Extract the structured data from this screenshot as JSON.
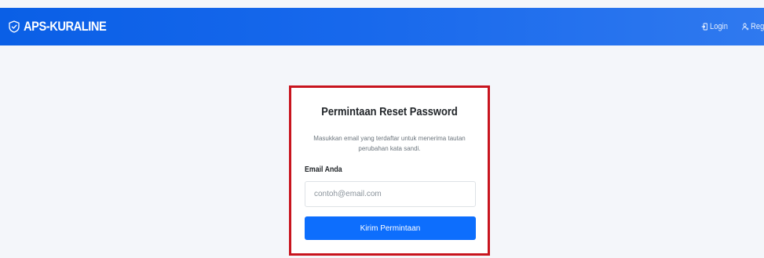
{
  "navbar": {
    "brand": "APS-KURALINE",
    "links": [
      {
        "label": "Login",
        "icon": "login-icon"
      },
      {
        "label": "Register",
        "icon": "user-add-icon"
      }
    ],
    "color": "#0d6efd"
  },
  "reset_card": {
    "title": "Permintaan Reset Password",
    "description": "Masukkan email yang terdaftar untuk menerima tautan perubahan kata sandi.",
    "email_label": "Email Anda",
    "email_placeholder": "contoh@email.com",
    "email_value": "",
    "submit_label": "Kirim Permintaan",
    "highlight_color": "#c8141e"
  }
}
